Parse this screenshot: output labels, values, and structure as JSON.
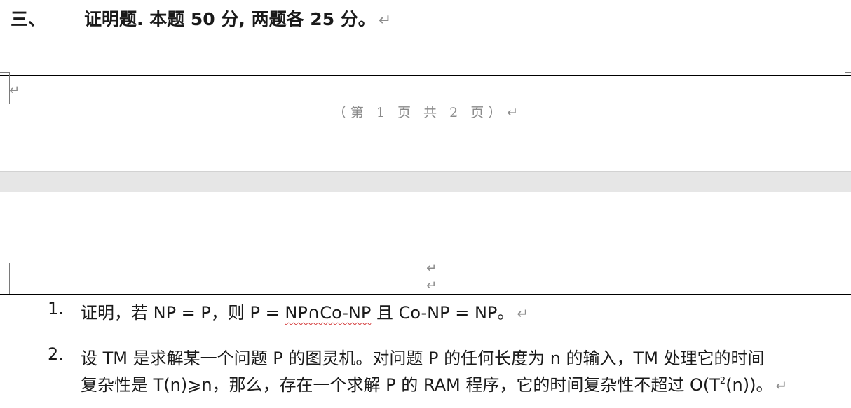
{
  "heading": {
    "number": "三、",
    "text": "证明题.  本题 50 分, 两题各 25 分。"
  },
  "marks": {
    "paragraph": "↵"
  },
  "footer": {
    "page_text": "（第 1 页 共 2 页）"
  },
  "questions": [
    {
      "number": "1.",
      "prefix": "证明，若 NP = P，则 P = ",
      "flagged_text": "NP∩Co-NP",
      "suffix": " 且 Co-NP = NP。"
    },
    {
      "number": "2.",
      "line1": "设 TM 是求解某一个问题 P 的图灵机。对问题 P 的任何长度为 n 的输入，TM 处理它的时间",
      "line2_prefix": "复杂性是 T(n)⩾n，那么，存在一个求解 P 的 RAM 程序，它的时间复杂性不超过 O(T",
      "line2_superscript": "2",
      "line2_suffix": "(n))。"
    }
  ],
  "colors": {
    "text": "#1a1a1a",
    "formatting_mark": "#8c8c8c",
    "footer_text": "#8a8a8a",
    "page_gap": "#e6e6e6",
    "spellcheck_underline": "#d43a3a"
  }
}
